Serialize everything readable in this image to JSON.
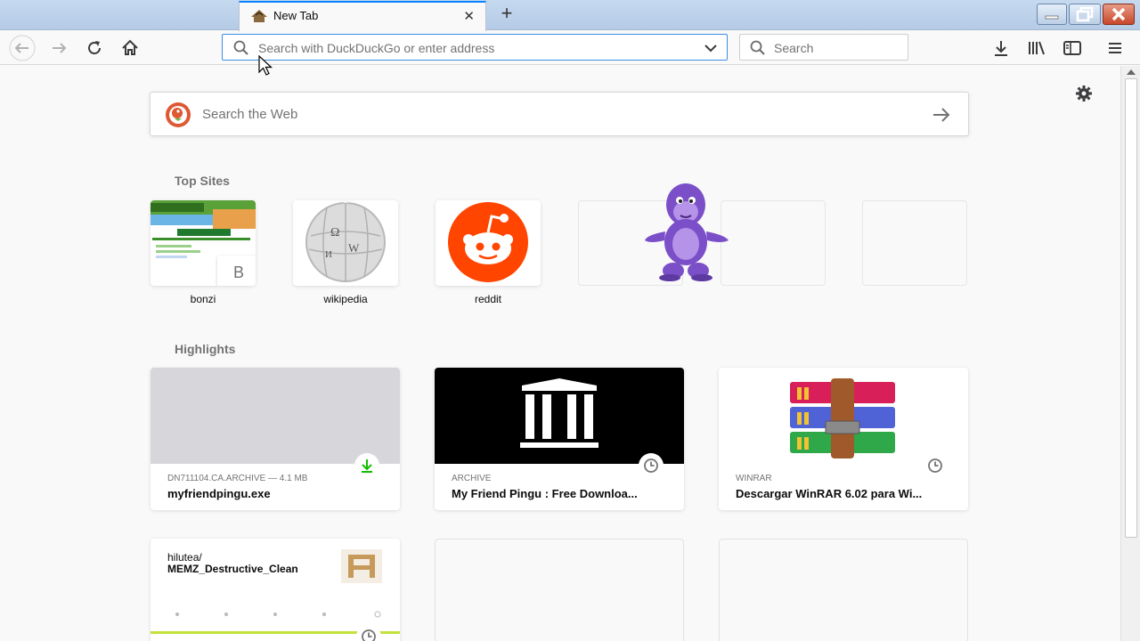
{
  "window": {
    "tab_title": "New Tab"
  },
  "navbar": {
    "address_placeholder": "Search with DuckDuckGo or enter address",
    "search_placeholder": "Search"
  },
  "page": {
    "web_search_placeholder": "Search the Web",
    "top_sites_title": "Top Sites",
    "top_sites": [
      {
        "label": "bonzi",
        "letter": "B"
      },
      {
        "label": "wikipedia"
      },
      {
        "label": "reddit"
      }
    ],
    "highlights_title": "Highlights",
    "highlights": [
      {
        "source": "DN711104.CA.ARCHIVE — 4.1 MB",
        "title": "myfriendpingu.exe",
        "badge": "download-icon"
      },
      {
        "source": "ARCHIVE",
        "title": "My Friend Pingu : Free Downloa...",
        "badge": "clock-icon"
      },
      {
        "source": "WINRAR",
        "title": "Descargar WinRAR 6.02 para Wi...",
        "badge": "clock-icon"
      },
      {
        "source": "hilutea/",
        "title": "MEMZ_Destructive_Clean",
        "badge": "clock-icon"
      }
    ]
  },
  "colors": {
    "accent": "#0a84ff",
    "reddit": "#ff4500",
    "duckduckgo": "#de5833",
    "download_green": "#12bc00"
  }
}
